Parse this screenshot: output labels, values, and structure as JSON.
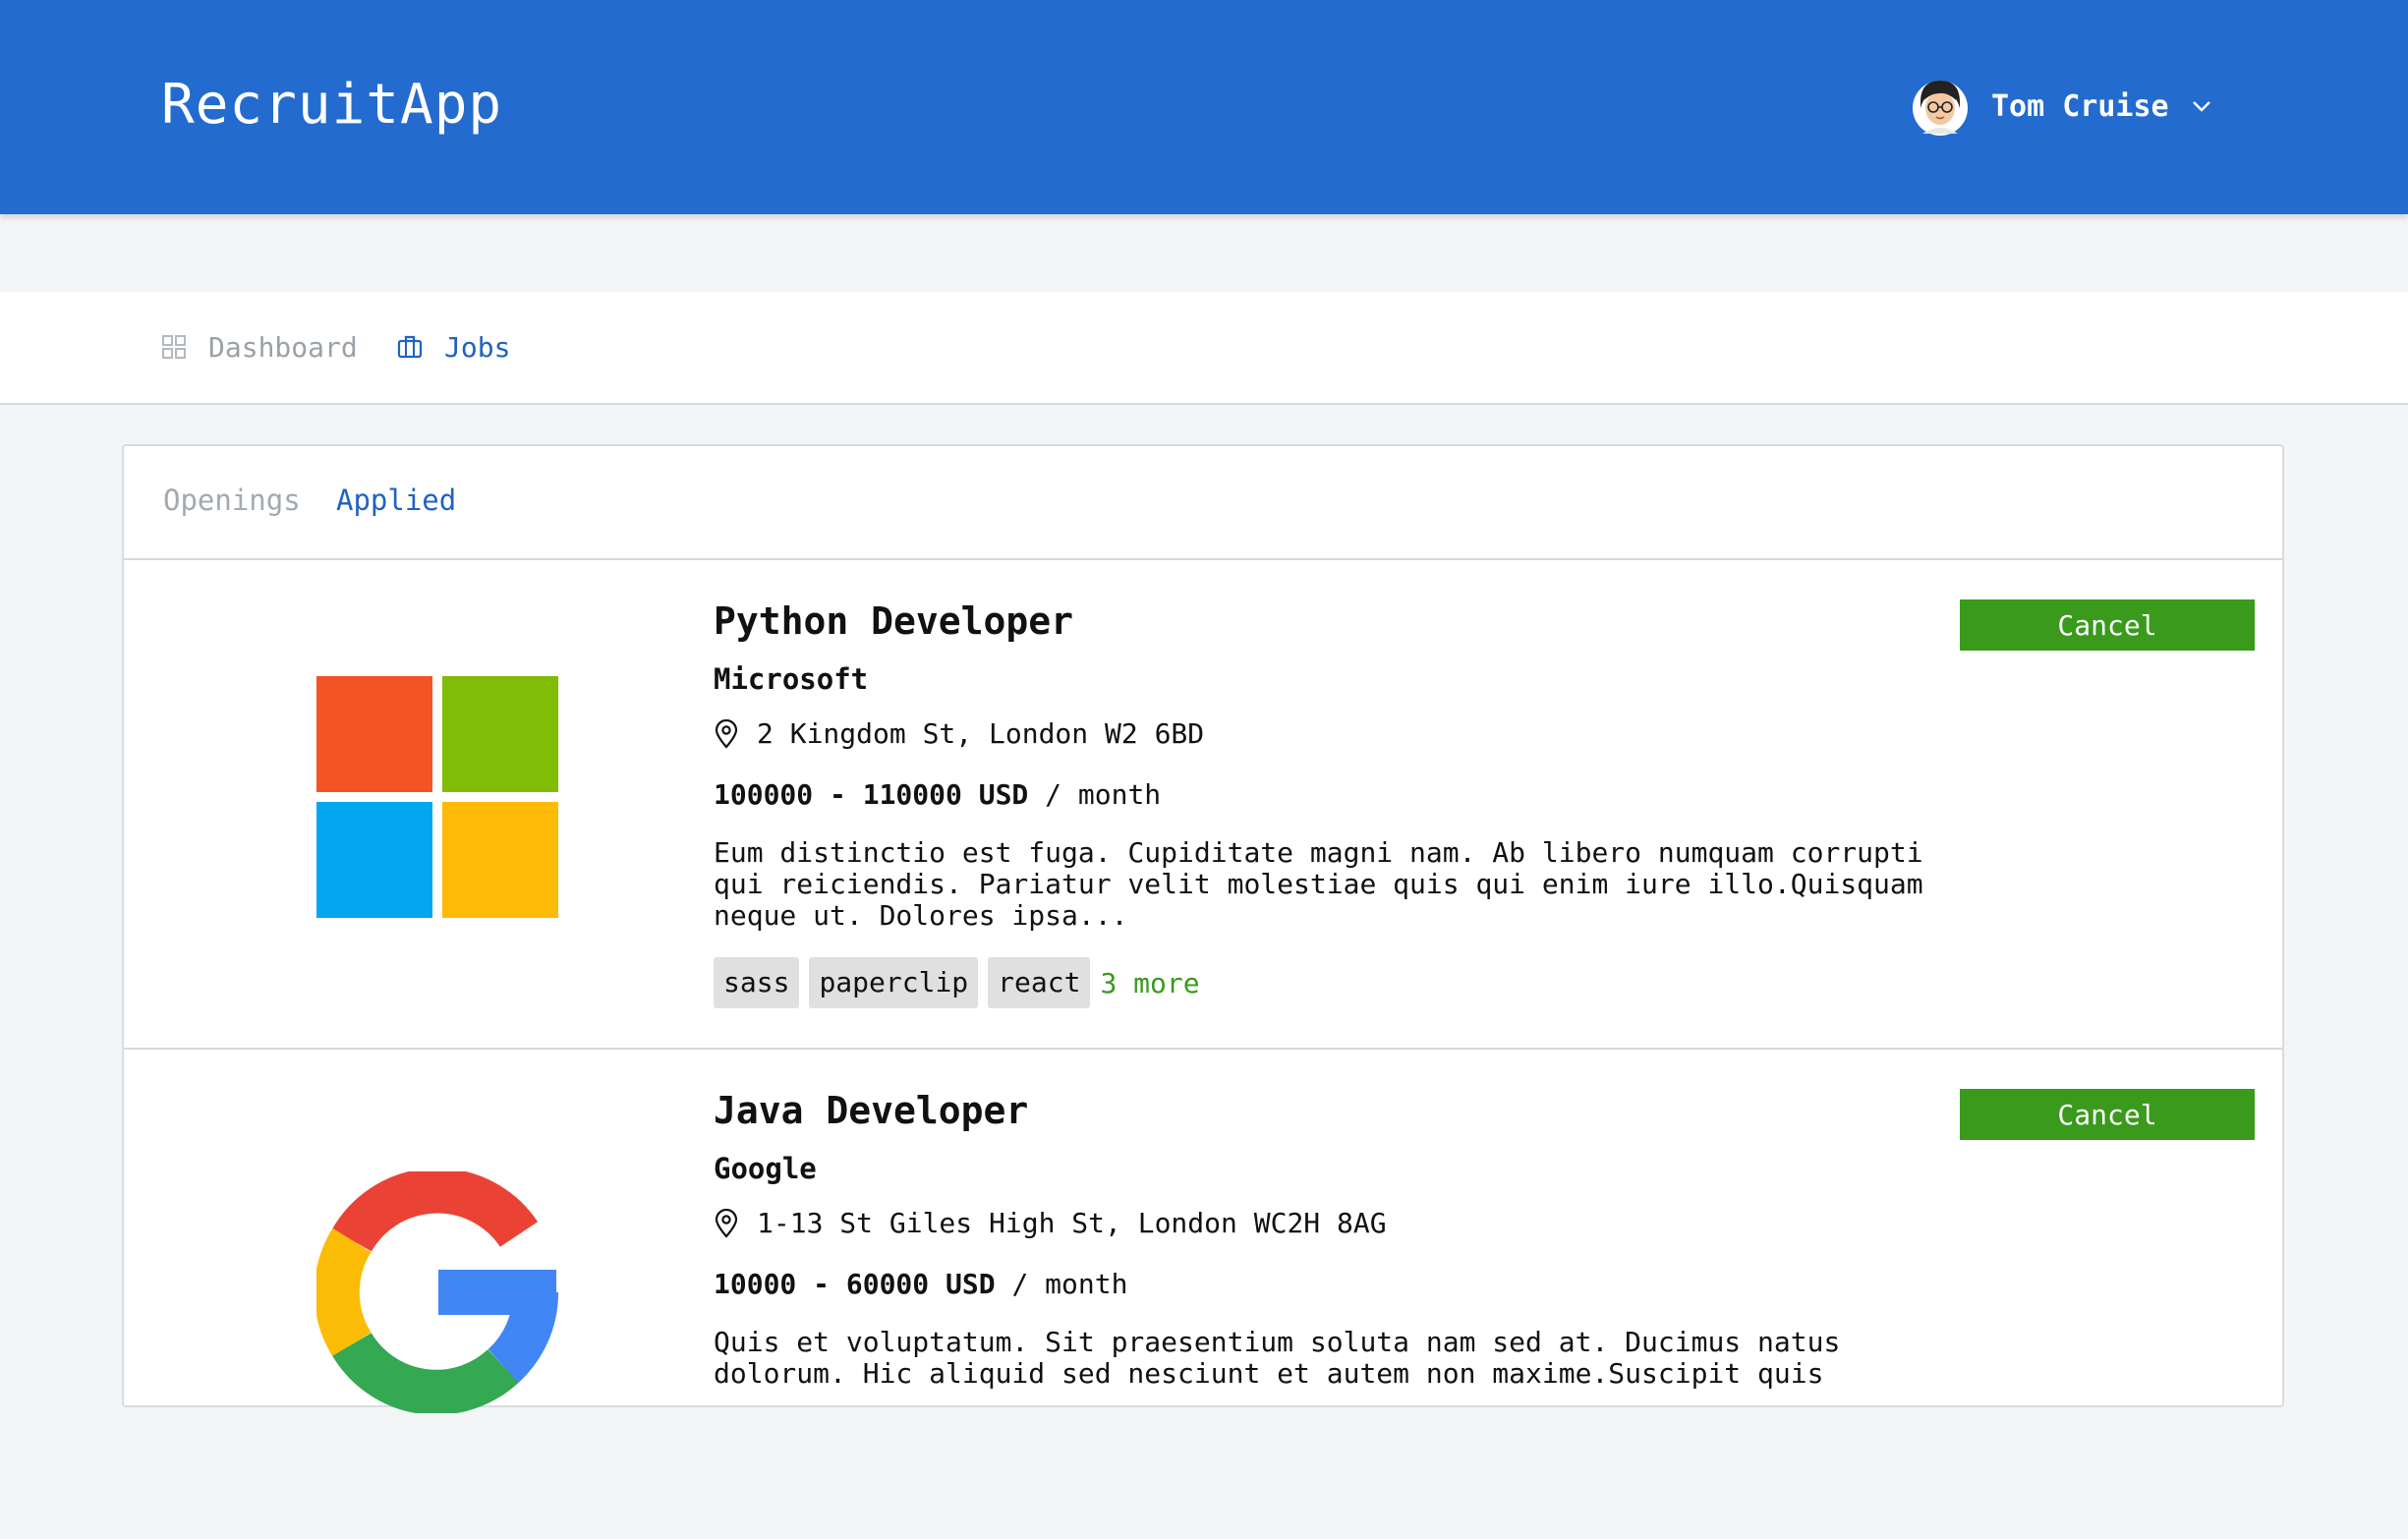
{
  "header": {
    "brand": "RecruitApp",
    "user_name": "Tom Cruise",
    "avatar_icon": "avatar-icon",
    "dropdown_icon": "chevron-down-icon",
    "background": "#236bce"
  },
  "nav": {
    "items": [
      {
        "label": "Dashboard",
        "icon": "grid-icon",
        "active": false
      },
      {
        "label": "Jobs",
        "icon": "briefcase-icon",
        "active": true
      }
    ]
  },
  "tabs": [
    {
      "label": "Openings",
      "active": false
    },
    {
      "label": "Applied",
      "active": true
    }
  ],
  "jobs": [
    {
      "title": "Python Developer",
      "company": "Microsoft",
      "logo": "microsoft-logo",
      "location": "2 Kingdom St, London W2 6BD",
      "salary_range": "100000 - 110000 USD",
      "salary_period": "/ month",
      "description": "Eum distinctio est fuga. Cupiditate magni nam. Ab libero numquam corrupti qui reiciendis. Pariatur velit molestiae quis qui enim iure illo.Quisquam neque ut. Dolores ipsa...",
      "tags": [
        "sass",
        "paperclip",
        "react"
      ],
      "more": "3 more",
      "action_label": "Cancel"
    },
    {
      "title": "Java Developer",
      "company": "Google",
      "logo": "google-logo",
      "location": "1-13 St Giles High St, London WC2H 8AG",
      "salary_range": "10000 - 60000 USD",
      "salary_period": "/ month",
      "description": "Quis et voluptatum. Sit praesentium soluta nam sed at. Ducimus natus dolorum. Hic aliquid sed nesciunt et autem non maxime.Suscipit quis",
      "action_label": "Cancel"
    }
  ],
  "colors": {
    "accent": "#1f62c2",
    "action": "#3a9a1c",
    "tag_bg": "#e0e0e0"
  }
}
